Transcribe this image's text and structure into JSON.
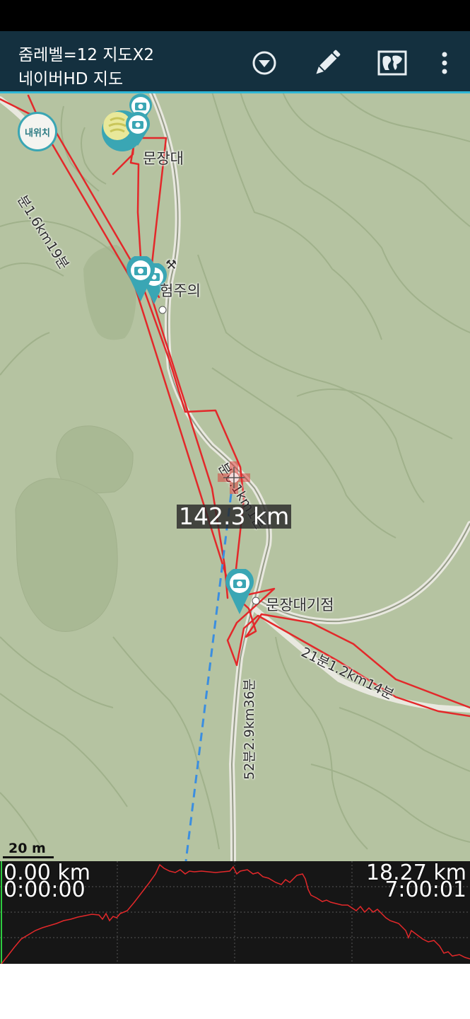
{
  "app_bar": {
    "title_line1": "줌레벨=12 지도X2",
    "title_line2": "네이버HD 지도",
    "actions": [
      {
        "name": "dropdown",
        "icon": "chevron-down-circle-icon"
      },
      {
        "name": "edit",
        "icon": "pencil-icon"
      },
      {
        "name": "map-layer",
        "icon": "map-picture-icon"
      },
      {
        "name": "more",
        "icon": "more-vertical-icon"
      }
    ]
  },
  "map": {
    "my_location_label": "내위치",
    "place_labels": {
      "mungjangdae": "문장대",
      "caution": "험주의",
      "junction": "문장대기점"
    },
    "trail_labels": {
      "seg1": "분1.6km19분",
      "seg2": "분0.1km1분",
      "seg3": "21분1.2km14분",
      "seg4": "52분2.9km36분"
    },
    "distance_readout": "142.3 km",
    "scale_label": "20 m",
    "colors": {
      "map_bg": "#b5c3a1",
      "trail": "#e5e5dd",
      "track": "#e3282a",
      "marker": "#3aa6b4",
      "guide_line": "#3b8ee0"
    }
  },
  "elevation": {
    "start_distance": "0.00 km",
    "start_time": "0:00:00",
    "end_distance": "18.27 km",
    "end_time": "7:00:01"
  }
}
